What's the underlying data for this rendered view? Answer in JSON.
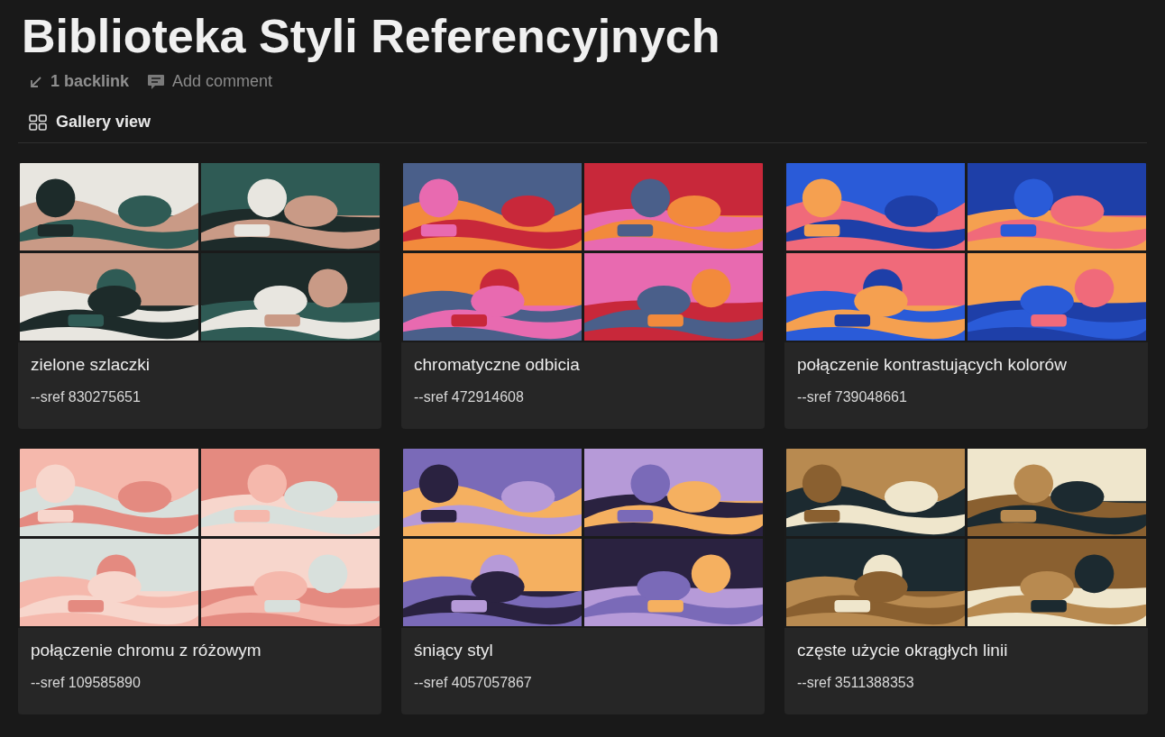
{
  "page": {
    "title": "Biblioteka Styli Referencyjnych",
    "backlinks": "1 backlink",
    "comment": "Add comment"
  },
  "view": {
    "label": "Gallery view"
  },
  "cards": [
    {
      "title": "zielone szlaczki",
      "sref": "--sref 830275651"
    },
    {
      "title": "chromatyczne odbicia",
      "sref": "--sref 472914608"
    },
    {
      "title": "połączenie kontrastujących kolorów",
      "sref": "--sref 739048661"
    },
    {
      "title": "połączenie chromu z różowym",
      "sref": "--sref 109585890"
    },
    {
      "title": "śniący styl",
      "sref": "--sref 4057057867"
    },
    {
      "title": "częste użycie okrągłych linii",
      "sref": "--sref 3511388353"
    }
  ]
}
